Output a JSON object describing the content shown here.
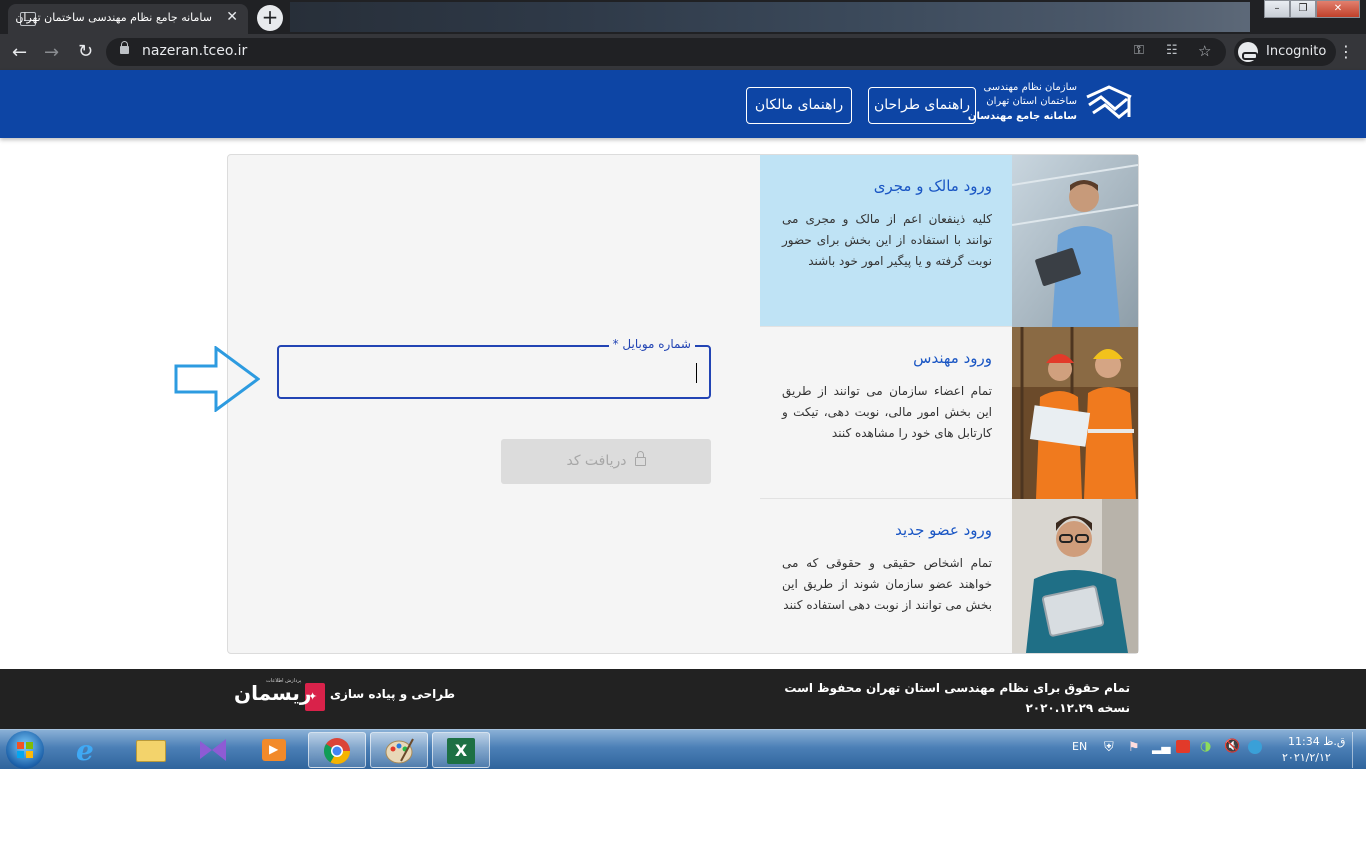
{
  "browser": {
    "tab_title": "سامانه جامع نظام مهندسی ساختمان تهران",
    "tab_close": "✕",
    "new_tab": "+",
    "url": "nazeran.tceo.ir",
    "profile_label": "Incognito",
    "window_buttons": {
      "minimize": "–",
      "maximize": "❐",
      "close": "✕"
    }
  },
  "header": {
    "logo_line1": "سازمان نظام مهندسی",
    "logo_line2": "ساختمان استان تهران",
    "logo_line3": "سامانه جامع مهندسان",
    "designers_guide": "راهنمای طراحان",
    "owners_guide": "راهنمای مالکان",
    "colors": {
      "primary": "#0d45a5",
      "link": "#1a56c4",
      "highlight": "#bfe3f5"
    }
  },
  "login": {
    "mobile_label": "شماره موبایل *",
    "mobile_value": "",
    "get_code": "دریافت کد"
  },
  "panels": [
    {
      "title": "ورود مالک و مجری",
      "desc": "کلیه ذینفعان اعم از مالک و مجری می توانند با استفاده از این بخش برای حضور نوبت گرفته و یا پیگیر امور خود باشند"
    },
    {
      "title": "ورود مهندس",
      "desc": "تمام اعضاء سازمان می توانند از طریق این بخش امور مالی، نوبت دهی، تیکت و کارتابل های خود را مشاهده کنند"
    },
    {
      "title": "ورود عضو جدید",
      "desc": "تمام اشخاص حقیقی و حقوقی که می خواهند عضو سازمان شوند از طریق این بخش می توانند از نوبت دهی استفاده کنند"
    }
  ],
  "footer": {
    "copyright": "تمام حقوق برای نظام مهندسی استان تهران محفوظ است",
    "version": "نسخه ۲۰۲۰.۱۲.۲۹",
    "designer": "طراحی و پیاده سازی",
    "brand": "ریسمان",
    "brand_tagline": "پردازش اطلاعات"
  },
  "taskbar": {
    "language": "EN",
    "time": "ق.ظ 11:34",
    "date": "۲۰۲۱/۲/۱۲"
  }
}
